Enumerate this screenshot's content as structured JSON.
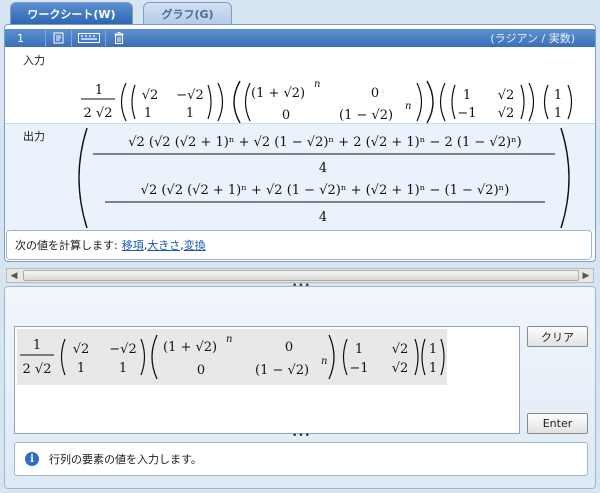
{
  "tabs": [
    {
      "label": "ワークシート(W)",
      "active": true
    },
    {
      "label": "グラフ(G)",
      "active": false
    }
  ],
  "worksheet": {
    "entry_number": "1",
    "mode": "(ラジアン / 実数)",
    "input_label": "入力",
    "output_label": "出力",
    "icons": [
      "edit-icon",
      "keyboard-icon",
      "trash-icon"
    ]
  },
  "suggestions": {
    "prefix": "次の値を計算します:",
    "links": [
      "移項",
      "大きさ",
      "変換"
    ],
    "sep": ", "
  },
  "buttons": {
    "clear": "クリア",
    "enter": "Enter"
  },
  "status": {
    "message": "行列の要素の値を入力します。"
  },
  "math": {
    "one": "1",
    "zero": "0",
    "minus_one": "−1",
    "two": "2",
    "four": "4",
    "n": "n",
    "sqrt2": "√2",
    "neg_sqrt2": "−√2",
    "one_plus_sqrt2": "(1 + √2)",
    "one_minus_sqrt2": "(1 − √2)",
    "two_sqrt2": "2 √2",
    "out1": "√2 (√2 (√2 + 1)ⁿ + √2 (1 − √2)ⁿ + 2 (√2 + 1)ⁿ − 2 (1 − √2)ⁿ)",
    "out2": "√2 (√2 (√2 + 1)ⁿ + √2 (1 − √2)ⁿ + (√2 + 1)ⁿ − (1 − √2)ⁿ)"
  }
}
